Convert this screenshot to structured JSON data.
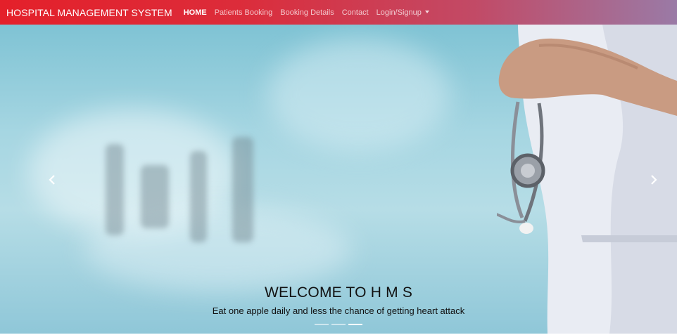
{
  "navbar": {
    "brand": "HOSPITAL MANAGEMENT SYSTEM",
    "links": [
      {
        "label": "HOME",
        "active": true
      },
      {
        "label": "Patients Booking"
      },
      {
        "label": "Booking Details"
      },
      {
        "label": "Contact"
      },
      {
        "label": "Login/Signup"
      }
    ],
    "gradient_colors": [
      "#e4202a",
      "#9a7aa6"
    ]
  },
  "carousel": {
    "caption_title": "WELCOME TO H M S",
    "caption_text": "Eat one apple daily and less the chance of getting heart attack",
    "indicator_count": 3,
    "active_indicator": 3,
    "prev_icon": "chevron-left-icon",
    "next_icon": "chevron-right-icon"
  }
}
